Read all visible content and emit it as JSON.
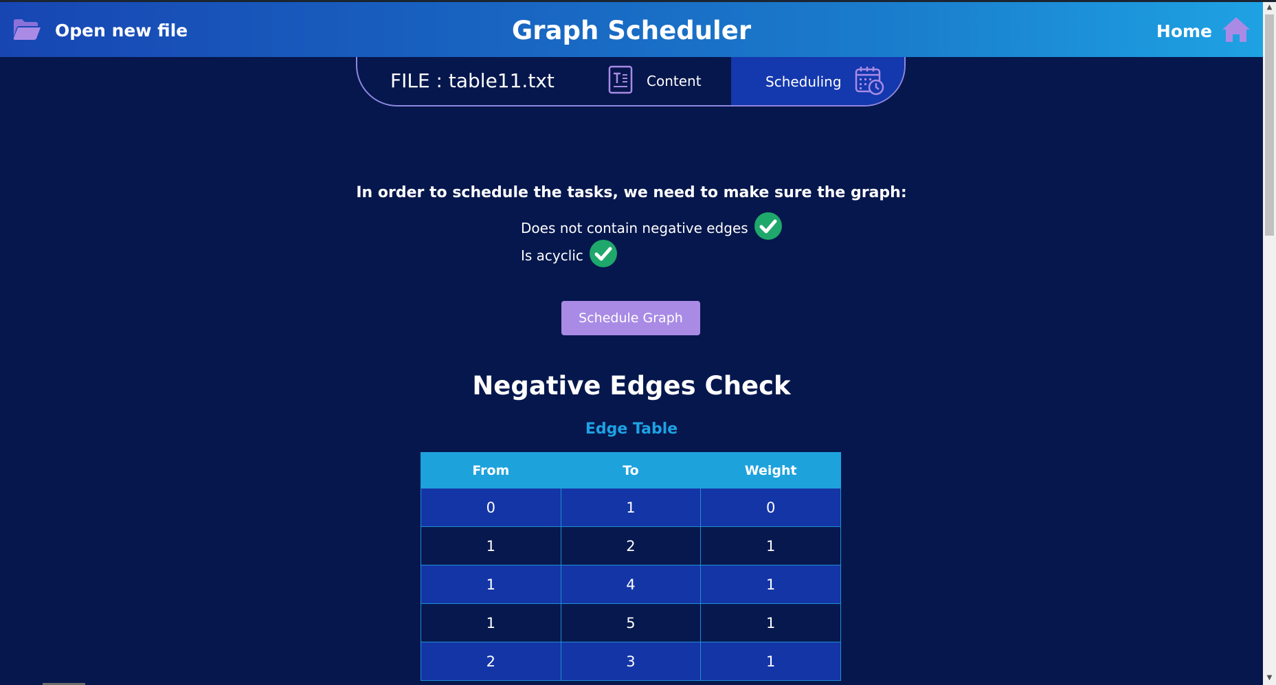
{
  "header": {
    "open_file_label": "Open new file",
    "app_title": "Graph Scheduler",
    "home_label": "Home"
  },
  "tabs": {
    "file_label": "FILE : table11.txt",
    "content_label": "Content",
    "scheduling_label": "Scheduling"
  },
  "requirements": {
    "intro": "In order to schedule the tasks, we need to make sure the graph:",
    "items": [
      {
        "label": "Does not contain negative edges",
        "passed": true
      },
      {
        "label": "Is acyclic",
        "passed": true
      }
    ]
  },
  "schedule_button": "Schedule Graph",
  "section_title": "Negative Edges Check",
  "edge_table": {
    "title": "Edge Table",
    "headers": [
      "From",
      "To",
      "Weight"
    ],
    "rows": [
      [
        "0",
        "1",
        "0"
      ],
      [
        "1",
        "2",
        "1"
      ],
      [
        "1",
        "4",
        "1"
      ],
      [
        "1",
        "5",
        "1"
      ],
      [
        "2",
        "3",
        "1"
      ]
    ]
  },
  "colors": {
    "background": "#06174d",
    "accent": "#1ea2e3",
    "button": "#a98be6",
    "check": "#1fa86b",
    "icon": "#9a7ee6"
  }
}
